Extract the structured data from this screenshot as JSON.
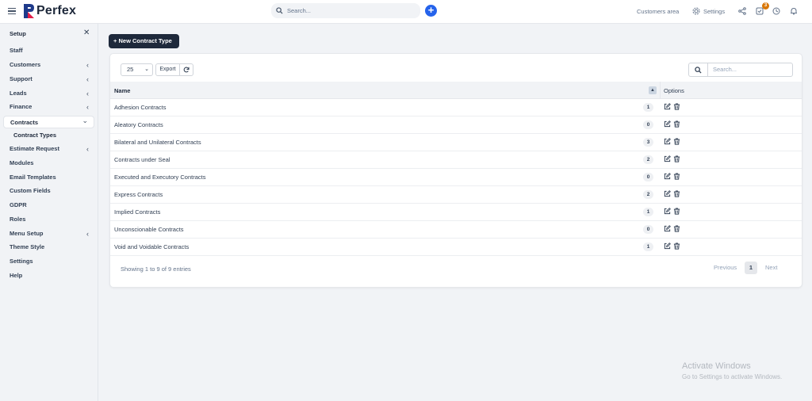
{
  "app": {
    "name": "Perfex"
  },
  "topbar": {
    "search_placeholder": "Search...",
    "customers_area": "Customers area",
    "settings": "Settings",
    "todo_badge": "3"
  },
  "sidebar": {
    "title": "Setup",
    "items": [
      {
        "label": "Staff"
      },
      {
        "label": "Customers",
        "chevron": "‹"
      },
      {
        "label": "Support",
        "chevron": "‹"
      },
      {
        "label": "Leads",
        "chevron": "‹"
      },
      {
        "label": "Finance",
        "chevron": "‹"
      },
      {
        "label": "Contracts",
        "chevron": "⌄"
      },
      {
        "label": "Estimate Request",
        "chevron": "‹"
      },
      {
        "label": "Modules"
      },
      {
        "label": "Email Templates"
      },
      {
        "label": "Custom Fields"
      },
      {
        "label": "GDPR"
      },
      {
        "label": "Roles"
      },
      {
        "label": "Menu Setup",
        "chevron": "‹"
      },
      {
        "label": "Theme Style"
      },
      {
        "label": "Settings"
      },
      {
        "label": "Help"
      }
    ],
    "subitem": "Contract Types"
  },
  "main": {
    "new_button": "New Contract Type",
    "page_length": "25",
    "export_label": "Export",
    "filter_placeholder": "Search...",
    "columns": {
      "name": "Name",
      "options": "Options"
    },
    "rows": [
      {
        "name": "Adhesion Contracts",
        "count": "1"
      },
      {
        "name": "Aleatory Contracts",
        "count": "0"
      },
      {
        "name": "Bilateral and Unilateral Contracts",
        "count": "3"
      },
      {
        "name": "Contracts under Seal",
        "count": "2"
      },
      {
        "name": "Executed and Executory Contracts",
        "count": "0"
      },
      {
        "name": "Express Contracts",
        "count": "2"
      },
      {
        "name": "Implied Contracts",
        "count": "1"
      },
      {
        "name": "Unconscionable Contracts",
        "count": "0"
      },
      {
        "name": "Void and Voidable Contracts",
        "count": "1"
      }
    ],
    "info": "Showing 1 to 9 of 9 entries",
    "pagination": {
      "previous": "Previous",
      "current": "1",
      "next": "Next"
    }
  },
  "watermark": {
    "title": "Activate Windows",
    "subtitle": "Go to Settings to activate Windows."
  },
  "colors": {
    "accent": "#2563eb",
    "dark_button": "#1e293b",
    "badge": "#d97706"
  }
}
